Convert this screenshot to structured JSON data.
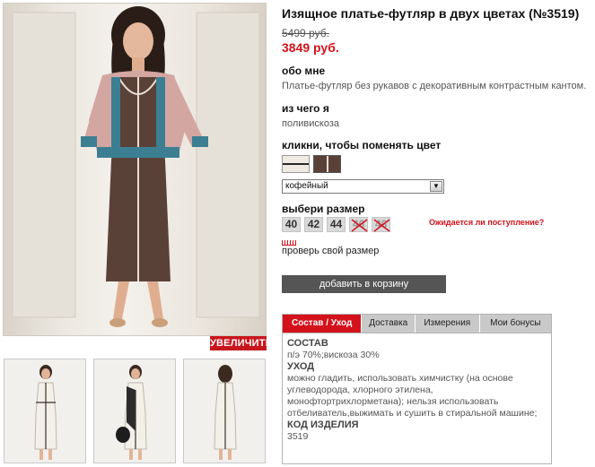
{
  "product": {
    "title": "Изящное платье-футляр в двух цветах (№3519)",
    "old_price": "5499 руб.",
    "new_price": "3849 руб."
  },
  "about": {
    "heading": "обо мне",
    "text": "Платье-футляр без рукавов с декоративным контрастным кантом."
  },
  "material": {
    "heading": "из чего я",
    "text": "поливискоза"
  },
  "colors": {
    "heading": "кликни, чтобы поменять цвет",
    "selected_value": "кофейный",
    "arrow": "▼"
  },
  "sizes": {
    "heading": "выбери размер",
    "options": [
      {
        "label": "40",
        "available": true
      },
      {
        "label": "42",
        "available": true
      },
      {
        "label": "44",
        "available": true
      },
      {
        "label": "46",
        "available": false
      },
      {
        "label": "48",
        "available": false
      }
    ],
    "awaiting_link": "Ожидается ли поступление?",
    "check_size": "проверь свой размер"
  },
  "actions": {
    "add_to_cart": "добавить в корзину",
    "zoom": "УВЕЛИЧИТЬ"
  },
  "tabs": [
    {
      "label": "Состав / Уход",
      "active": true
    },
    {
      "label": "Доставка",
      "active": false
    },
    {
      "label": "Измерения",
      "active": false
    },
    {
      "label": "Мои бонусы",
      "active": false
    }
  ],
  "tab_content": {
    "composition_heading": "СОСТАВ",
    "composition_text": "п/э 70%;вискоза 30%",
    "care_heading": "УХОД",
    "care_text": "можно гладить, использовать химчистку (на основе углеводорода, хлорного этилена, монофтортрихлорметана); нельзя использовать отбеливатель,выжимать и сушить в стиральной машине;",
    "code_heading": "КОД ИЗДЕЛИЯ",
    "code_text": "3519"
  },
  "theme": {
    "accent": "#d4121b",
    "button_dark": "#555555",
    "size_box": "#d9d9d9"
  }
}
